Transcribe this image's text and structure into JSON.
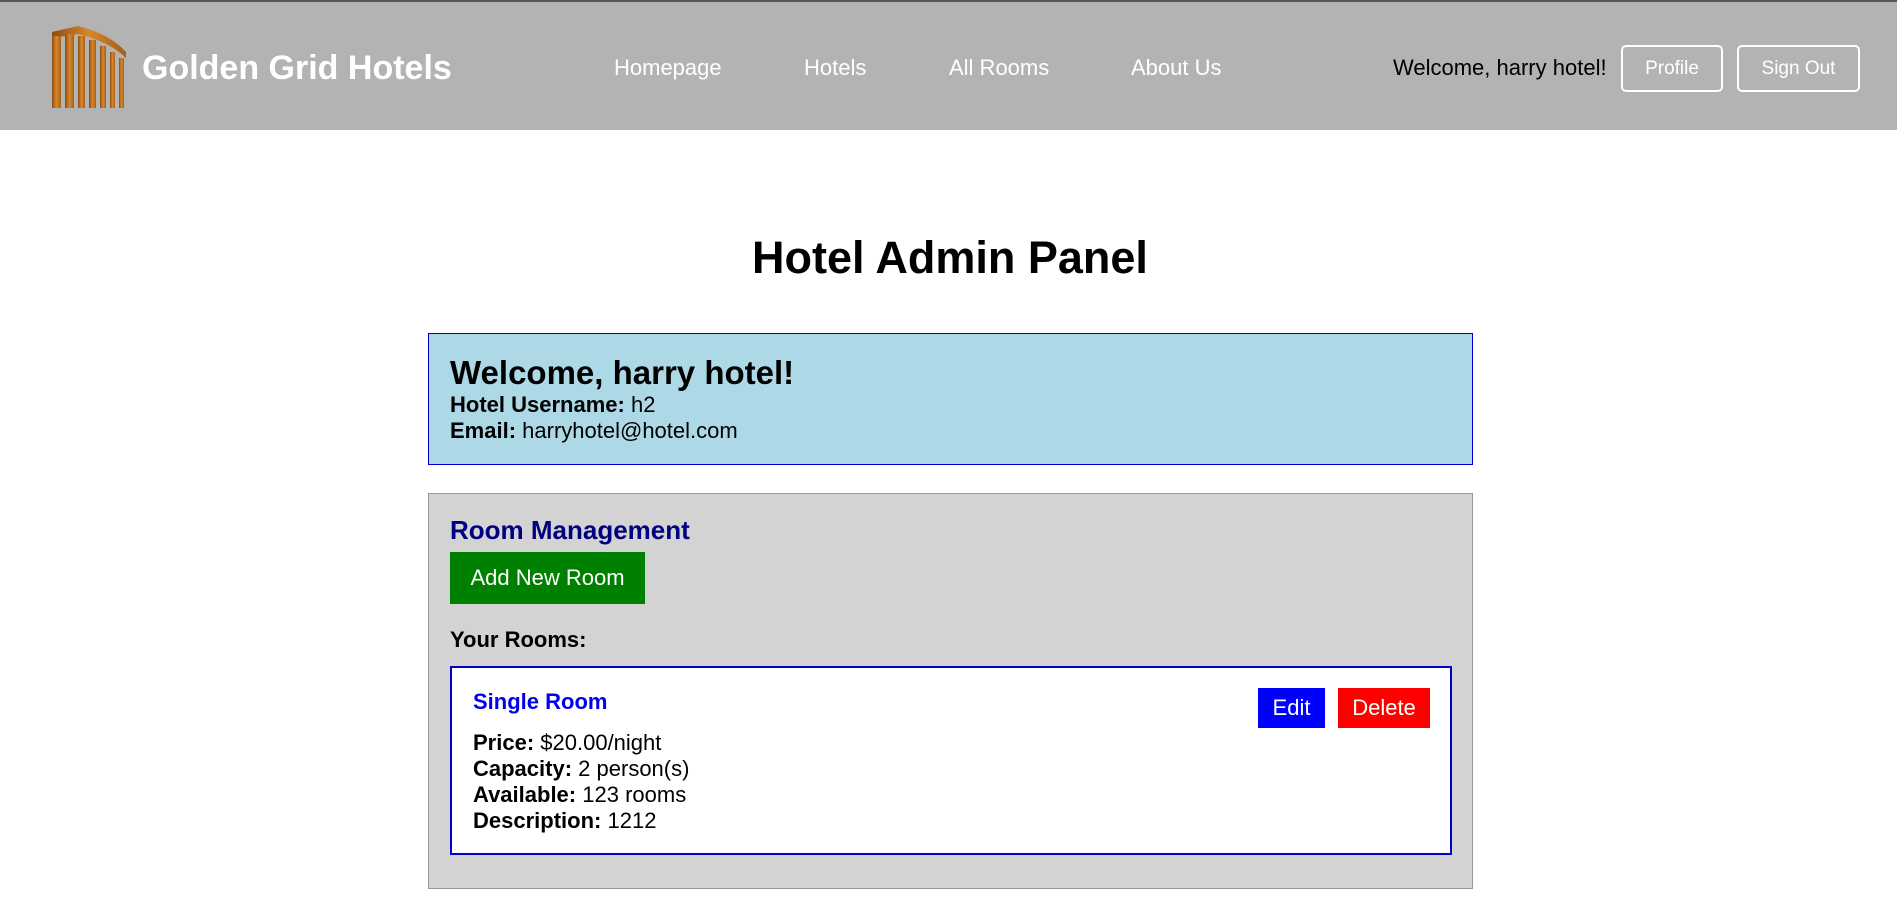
{
  "header": {
    "brand": "Golden Grid Hotels",
    "nav": [
      "Homepage",
      "Hotels",
      "All Rooms",
      "About Us"
    ],
    "welcome": "Welcome, harry hotel!",
    "profile_label": "Profile",
    "signout_label": "Sign Out",
    "logo_icon": "building-icon",
    "logo_color": "#c0731c"
  },
  "page": {
    "title": "Hotel Admin Panel"
  },
  "welcome_panel": {
    "greeting": "Welcome, harry hotel!",
    "username_label": "Hotel Username:",
    "username": "h2",
    "email_label": "Email:",
    "email": "harryhotel@hotel.com"
  },
  "room_management": {
    "title": "Room Management",
    "add_label": "Add New Room",
    "your_rooms_label": "Your Rooms:",
    "rooms": [
      {
        "name": "Single Room",
        "price_label": "Price:",
        "price": "$20.00/night",
        "capacity_label": "Capacity:",
        "capacity": "2 person(s)",
        "available_label": "Available:",
        "available": "123 rooms",
        "description_label": "Description:",
        "description": "1212",
        "edit_label": "Edit",
        "delete_label": "Delete"
      }
    ]
  },
  "colors": {
    "header_bg": "#b3b3b3",
    "welcome_bg": "#add8e6",
    "panel_bg": "#d3d3d3",
    "add_button": "#008000",
    "edit_button": "#0000ff",
    "delete_button": "#ff0000",
    "room_name": "#0000ee",
    "section_title": "#000080"
  }
}
